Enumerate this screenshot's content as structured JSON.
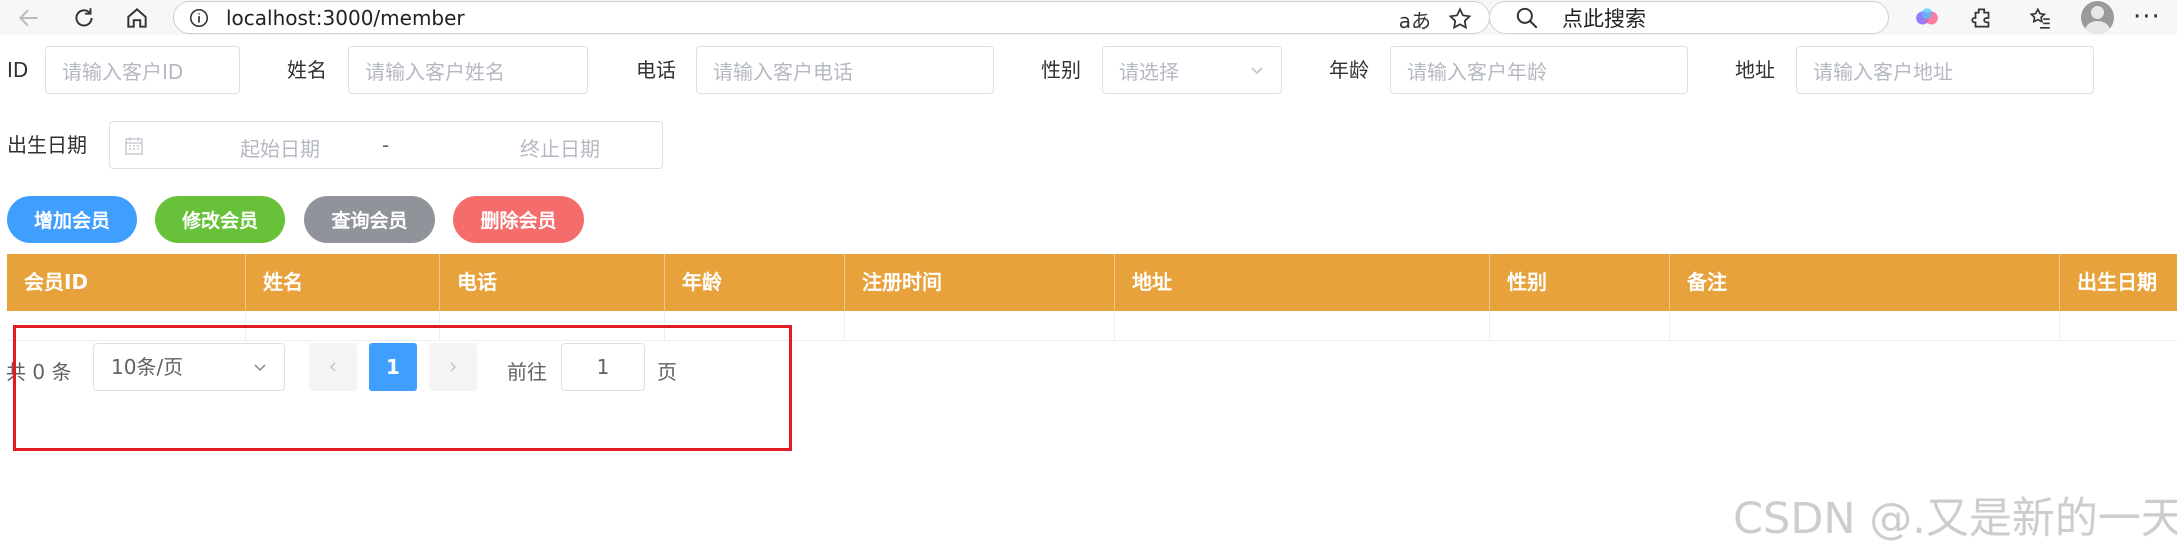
{
  "browser": {
    "url": "localhost:3000/member",
    "search_placeholder": "点此搜索",
    "read_aloud_label": "aあ"
  },
  "form": {
    "id": {
      "label": "ID",
      "placeholder": "请输入客户ID"
    },
    "name": {
      "label": "姓名",
      "placeholder": "请输入客户姓名"
    },
    "phone": {
      "label": "电话",
      "placeholder": "请输入客户电话"
    },
    "gender": {
      "label": "性别",
      "placeholder": "请选择"
    },
    "age": {
      "label": "年龄",
      "placeholder": "请输入客户年龄"
    },
    "address": {
      "label": "地址",
      "placeholder": "请输入客户地址"
    },
    "birth": {
      "label": "出生日期",
      "start_placeholder": "起始日期",
      "separator": "-",
      "end_placeholder": "终止日期"
    }
  },
  "buttons": {
    "add": "增加会员",
    "edit": "修改会员",
    "query": "查询会员",
    "delete": "删除会员"
  },
  "colors": {
    "add": "#409eff",
    "edit": "#67c23a",
    "query": "#909399",
    "delete": "#f56c6c",
    "table_header": "#e8a23c"
  },
  "table": {
    "columns": [
      "会员ID",
      "姓名",
      "电话",
      "年龄",
      "注册时间",
      "地址",
      "性别",
      "备注",
      "出生日期"
    ]
  },
  "pagination": {
    "total": "共 0 条",
    "page_size": "10条/页",
    "current_page": "1",
    "goto_label": "前往",
    "goto_value": "1",
    "page_suffix": "页"
  },
  "watermark": "CSDN @.又是新的一天."
}
